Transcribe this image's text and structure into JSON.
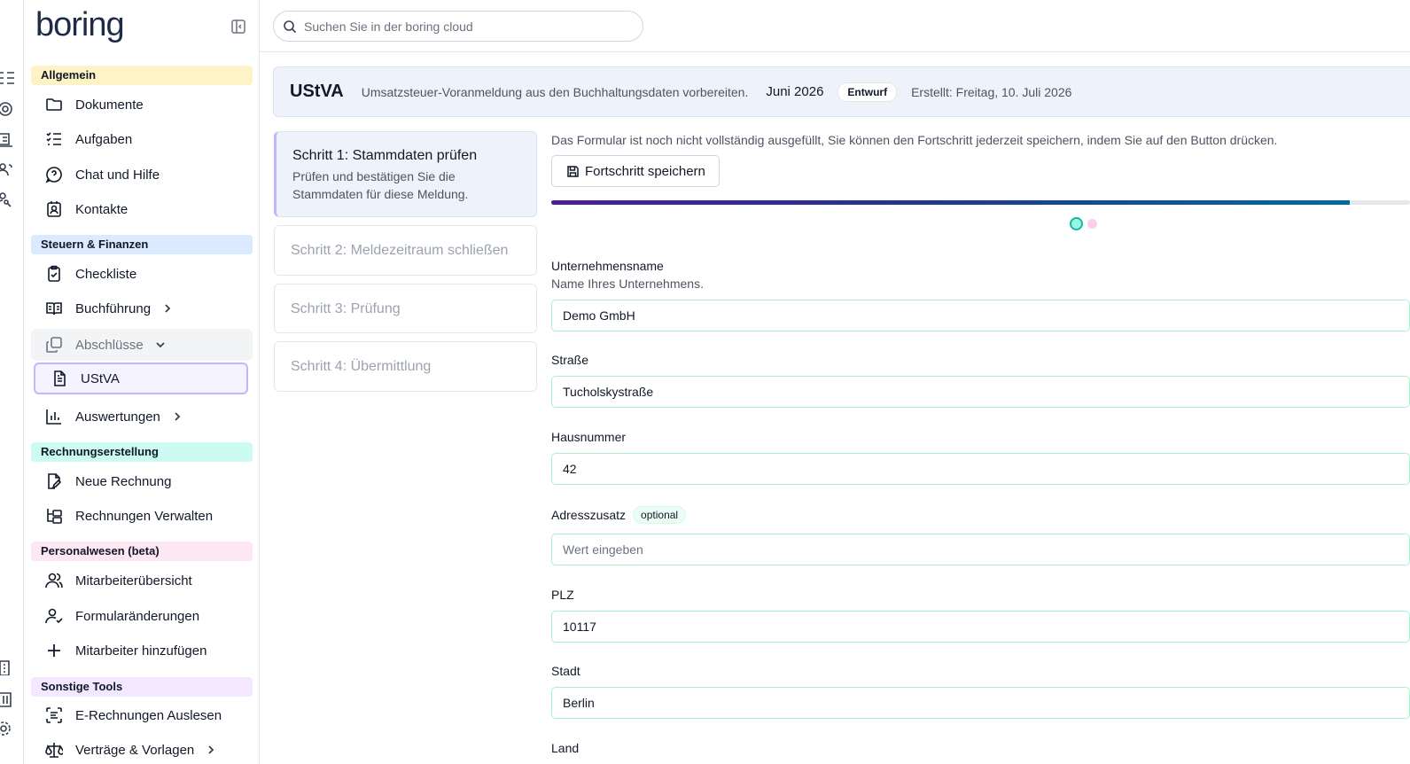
{
  "app": {
    "logo": "boring"
  },
  "search": {
    "placeholder": "Suchen Sie in der boring cloud"
  },
  "rail": {
    "icons": [
      "list-icon",
      "coin-icon",
      "ledger-icon",
      "users-icon",
      "person-search-icon",
      "building-icon",
      "library-icon",
      "gear-icon"
    ]
  },
  "sidebar": {
    "sections": {
      "allgemein": {
        "label": "Allgemein",
        "color": "#fef3c7"
      },
      "steuern": {
        "label": "Steuern & Finanzen",
        "color": "#dbeafe"
      },
      "rechnung": {
        "label": "Rechnungserstellung",
        "color": "#ccfbf1"
      },
      "personal": {
        "label": "Personalwesen (beta)",
        "color": "#fce7f3"
      },
      "tools": {
        "label": "Sonstige Tools",
        "color": "#f3e8ff"
      }
    },
    "items": {
      "dokumente": "Dokumente",
      "aufgaben": "Aufgaben",
      "chat": "Chat und Hilfe",
      "kontakte": "Kontakte",
      "checkliste": "Checkliste",
      "buchfuehrung": "Buchführung",
      "abschluesse": "Abschlüsse",
      "ustva": "UStVA",
      "auswertungen": "Auswertungen",
      "neue_rechnung": "Neue Rechnung",
      "rechnungen_verwalten": "Rechnungen Verwalten",
      "mitarbeiter": "Mitarbeiterübersicht",
      "formular": "Formularänderungen",
      "mitarbeiter_add": "Mitarbeiter hinzufügen",
      "e_rechnungen": "E-Rechnungen Auslesen",
      "vertraege": "Verträge & Vorlagen"
    }
  },
  "header": {
    "title": "UStVA",
    "description": "Umsatzsteuer-Voranmeldung aus den Buchhaltungsdaten vorbereiten.",
    "period": "Juni 2026",
    "status": "Entwurf",
    "created": "Erstellt: Freitag, 10. Juli 2026"
  },
  "steps": [
    {
      "title": "Schritt 1: Stammdaten prüfen",
      "description": "Prüfen und bestätigen Sie die Stammdaten für diese Meldung."
    },
    {
      "title": "Schritt 2: Meldezeitraum schließen"
    },
    {
      "title": "Schritt 3: Prüfung"
    },
    {
      "title": "Schritt 4: Übermittlung"
    }
  ],
  "form": {
    "notice": "Das Formular ist noch nicht vollständig ausgefüllt, Sie können den Fortschritt jederzeit speichern, indem Sie auf den Button drücken.",
    "save_label": "Fortschritt speichern",
    "progress": 0.93,
    "fields": {
      "company": {
        "label": "Unternehmensname",
        "hint": "Name Ihres Unternehmens.",
        "value": "Demo GmbH"
      },
      "street": {
        "label": "Straße",
        "value": "Tucholskystraße"
      },
      "number": {
        "label": "Hausnummer",
        "value": "42"
      },
      "extra": {
        "label": "Adresszusatz",
        "badge": "optional",
        "value": "",
        "placeholder": "Wert eingeben"
      },
      "zip": {
        "label": "PLZ",
        "value": "10117"
      },
      "city": {
        "label": "Stadt",
        "value": "Berlin"
      },
      "country": {
        "label": "Land"
      }
    }
  }
}
